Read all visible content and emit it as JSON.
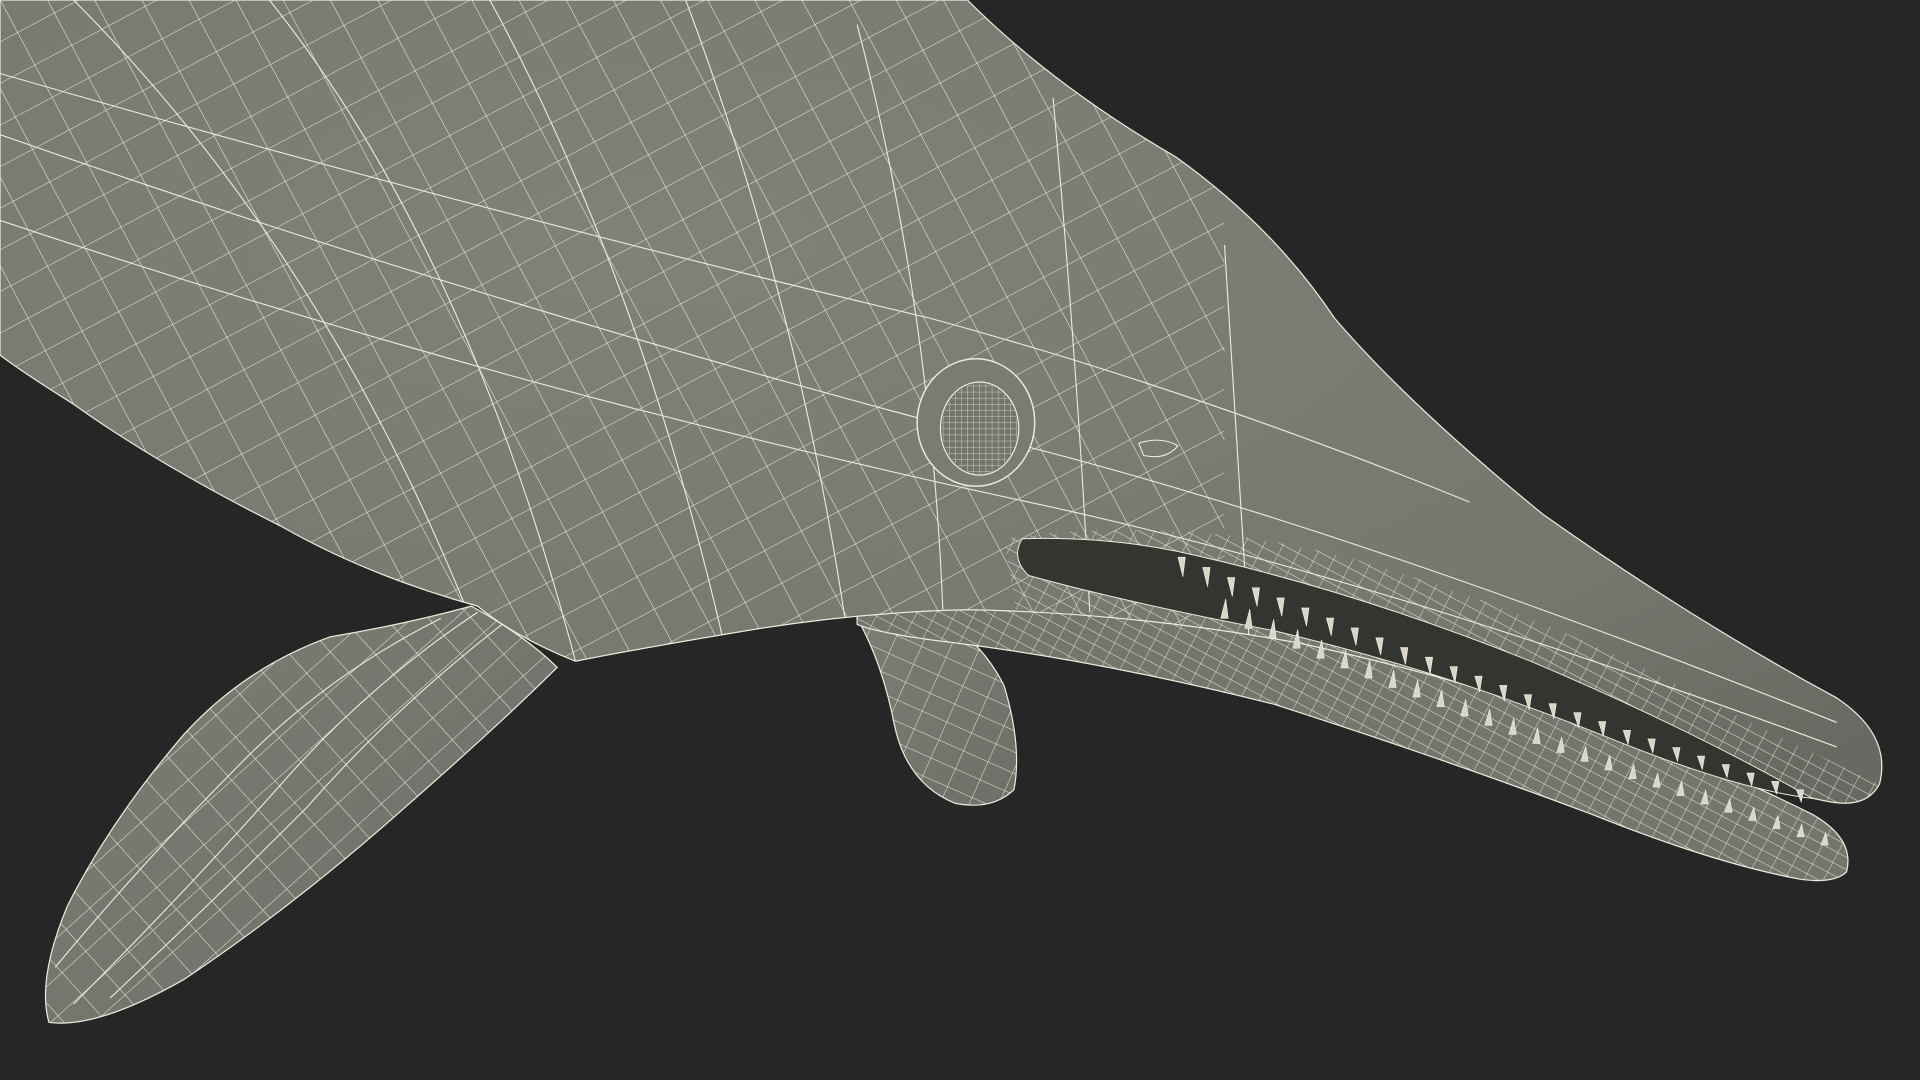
{
  "scene": {
    "subject": "ichthyosaur-3d-wireframe-model",
    "render_style": "wireframe-over-shaded",
    "colors": {
      "background": "#262626",
      "surface": "#797a72",
      "surface_shadow": "#6b6c65",
      "wire": "#eceadc",
      "mouth_interior": "#333630",
      "teeth": "#d9d6c8"
    }
  }
}
